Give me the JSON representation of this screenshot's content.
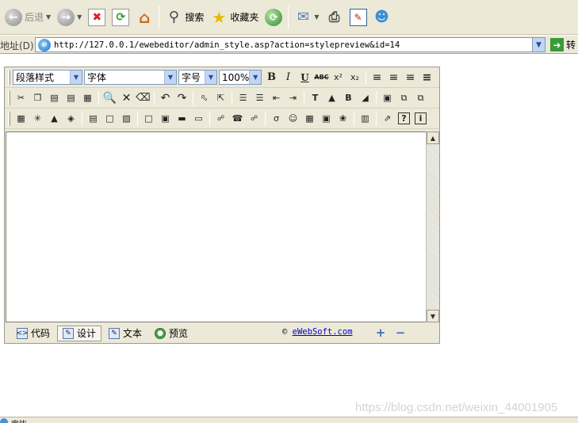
{
  "ie_toolbar": {
    "back_label": "后退",
    "search_label": "搜索",
    "favorites_label": "收藏夹"
  },
  "address_bar": {
    "label": "地址(D)",
    "url": "http://127.0.0.1/ewebeditor/admin_style.asp?action=stylepreview&id=14",
    "go_label": "转"
  },
  "editor": {
    "paragraph_style": "段落样式",
    "font_name": "字体",
    "font_size": "字号",
    "zoom": "100%",
    "bottom_tabs": [
      {
        "label": "代码",
        "icon": "code-icon"
      },
      {
        "label": "设计",
        "icon": "design-icon"
      },
      {
        "label": "文本",
        "icon": "text-icon"
      },
      {
        "label": "预览",
        "icon": "preview-icon"
      }
    ],
    "copyright_symbol": "©",
    "copyright_link": "eWebSoft.com"
  },
  "watermark": "https://blog.csdn.net/weixin_44001905",
  "status_text": "完毕"
}
